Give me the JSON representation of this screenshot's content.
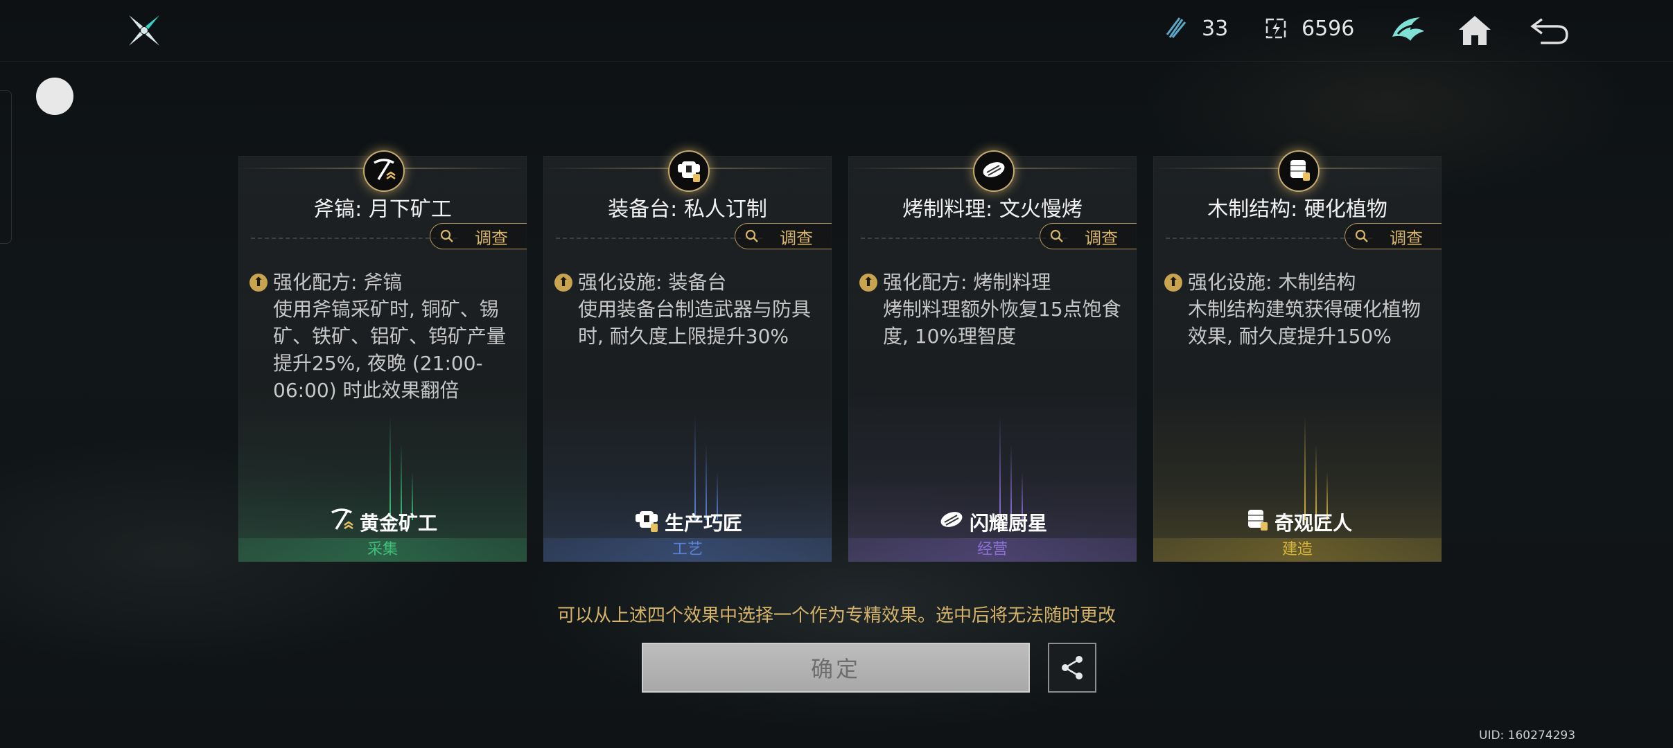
{
  "topbar": {
    "resource1_value": "33",
    "resource1_icon": "crystal-shard-icon",
    "resource2_value": "6596",
    "resource2_icon": "energy-box-icon",
    "buttons": [
      "emblem-icon",
      "home-icon",
      "back-icon"
    ]
  },
  "cards": [
    {
      "title": "斧镐: 月下矿工",
      "investigate": "调查",
      "effect_head": "强化配方: 斧镐",
      "effect_desc": "使用斧镐采矿时, 铜矿、锡矿、铁矿、铝矿、钨矿产量提升25%, 夜晚 (21:00-06:00) 时此效果翻倍",
      "badge": "黄金矿工",
      "category": "采集",
      "accent": "#3fbf7a",
      "icon": "pickaxe-icon"
    },
    {
      "title": "装备台: 私人订制",
      "investigate": "调查",
      "effect_head": "强化设施: 装备台",
      "effect_desc": "使用装备台制造武器与防具时, 耐久度上限提升30%",
      "badge": "生产巧匠",
      "category": "工艺",
      "accent": "#5a82d8",
      "icon": "armor-icon"
    },
    {
      "title": "烤制料理: 文火慢烤",
      "investigate": "调查",
      "effect_head": "强化配方: 烤制料理",
      "effect_desc": "烤制料理额外恢复15点饱食度, 10%理智度",
      "badge": "闪耀厨星",
      "category": "经营",
      "accent": "#8b6fd6",
      "icon": "grilled-meat-icon"
    },
    {
      "title": "木制结构: 硬化植物",
      "investigate": "调查",
      "effect_head": "强化设施: 木制结构",
      "effect_desc": "木制结构建筑获得硬化植物效果, 耐久度提升150%",
      "badge": "奇观匠人",
      "category": "建造",
      "accent": "#d6b53a",
      "icon": "wood-structure-icon"
    }
  ],
  "hint": "可以从上述四个效果中选择一个作为专精效果。选中后将无法随时更改",
  "confirm_label": "确定",
  "uid": "UID: 160274293"
}
